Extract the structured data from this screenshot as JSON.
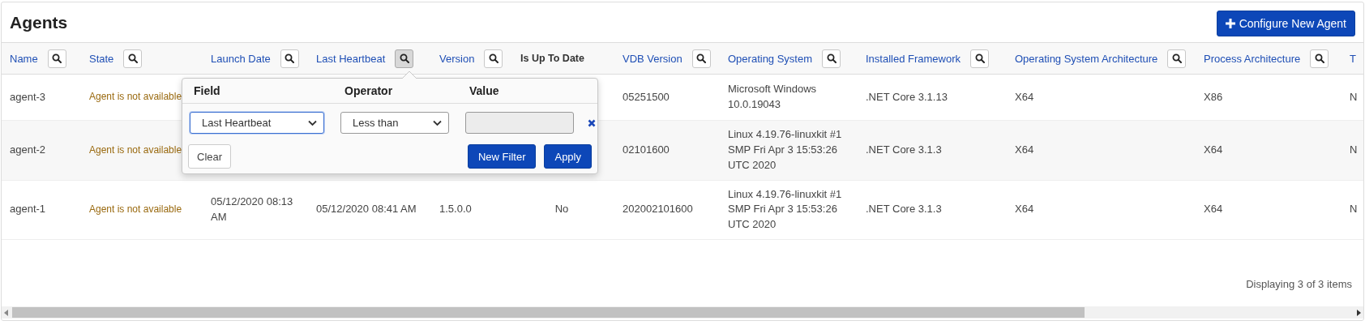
{
  "page": {
    "title": "Agents",
    "primary_button": {
      "label": "Configure New Agent"
    }
  },
  "table": {
    "columns": [
      {
        "label": "Name",
        "kind": "text",
        "link": true,
        "filter": true
      },
      {
        "label": "State",
        "kind": "status",
        "link": true,
        "filter": true
      },
      {
        "label": "Launch Date",
        "kind": "text",
        "link": true,
        "filter": true
      },
      {
        "label": "Last Heartbeat",
        "kind": "text",
        "link": true,
        "filter": true,
        "filter_active": true
      },
      {
        "label": "Version",
        "kind": "text",
        "link": true,
        "filter": true
      },
      {
        "label": "Is Up To Date",
        "kind": "flag",
        "link": false,
        "filter": false
      },
      {
        "label": "VDB Version",
        "kind": "text",
        "link": true,
        "filter": true
      },
      {
        "label": "Operating System",
        "kind": "text",
        "link": true,
        "filter": true
      },
      {
        "label": "Installed Framework",
        "kind": "text",
        "link": true,
        "filter": true
      },
      {
        "label": "Operating System Architecture",
        "kind": "text",
        "link": true,
        "filter": true
      },
      {
        "label": "Process Architecture",
        "kind": "text",
        "link": true,
        "filter": true
      },
      {
        "label": "T",
        "kind": "text",
        "link": true,
        "filter": false
      }
    ],
    "rows": [
      {
        "cells": [
          "agent-3",
          "Agent is not available",
          null,
          null,
          null,
          null,
          "05251500",
          "Microsoft Windows 10.0.19043",
          ".NET Core 3.1.13",
          "X64",
          "X86",
          "N"
        ]
      },
      {
        "cells": [
          "agent-2",
          "Agent is not available",
          null,
          null,
          null,
          null,
          "02101600",
          "Linux 4.19.76-linuxkit #1 SMP Fri Apr 3 15:53:26 UTC 2020",
          ".NET Core 3.1.3",
          "X64",
          "X64",
          "N"
        ]
      },
      {
        "cells": [
          "agent-1",
          "Agent is not available",
          "05/12/2020 08:13 AM",
          "05/12/2020 08:41 AM",
          "1.5.0.0",
          "No",
          "202002101600",
          "Linux 4.19.76-linuxkit #1 SMP Fri Apr 3 15:53:26 UTC 2020",
          ".NET Core 3.1.3",
          "X64",
          "X64",
          "N"
        ]
      }
    ],
    "footer": "Displaying 3 of 3 items"
  },
  "filter_popup": {
    "headers": [
      "Field",
      "Operator",
      "Value"
    ],
    "rows": [
      {
        "field": "Last Heartbeat",
        "field_focused": true,
        "operator": "Less than",
        "value_disabled": true
      }
    ],
    "buttons": [
      {
        "label": "Clear",
        "kind": "secondary"
      },
      {
        "label": "New Filter",
        "kind": "primary"
      },
      {
        "label": "Apply",
        "kind": "primary"
      }
    ]
  }
}
